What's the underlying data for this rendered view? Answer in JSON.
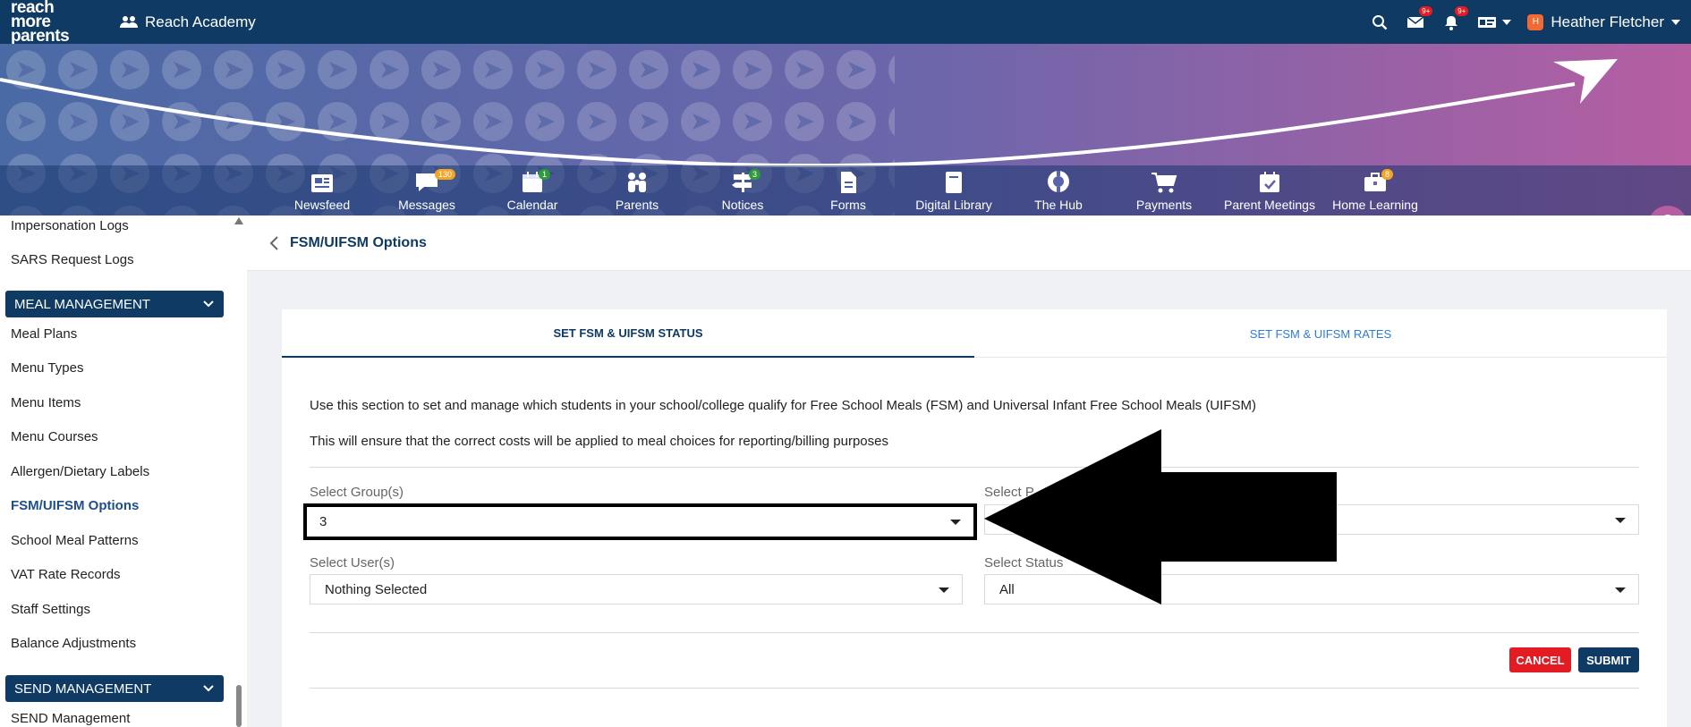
{
  "brand": {
    "line1": "reach more",
    "line2": "parents"
  },
  "school_name": "Reach Academy",
  "topbar": {
    "messages_badge": "9+",
    "notifications_badge": "9+",
    "user_initial": "H",
    "user_name": "Heather Fletcher"
  },
  "nav": [
    {
      "label": "Newsfeed",
      "icon": "newspaper-icon",
      "badge": ""
    },
    {
      "label": "Messages",
      "icon": "chat-icon",
      "badge": "130",
      "badge_color": "#f5a524"
    },
    {
      "label": "Calendar",
      "icon": "calendar-icon",
      "badge": "1",
      "badge_color": "#2e9b3a"
    },
    {
      "label": "Parents",
      "icon": "family-icon",
      "badge": ""
    },
    {
      "label": "Notices",
      "icon": "signpost-icon",
      "badge": "3",
      "badge_color": "#2e9b3a"
    },
    {
      "label": "Forms",
      "icon": "document-icon",
      "badge": ""
    },
    {
      "label": "Digital Library",
      "icon": "book-icon",
      "badge": ""
    },
    {
      "label": "The Hub",
      "icon": "lifebuoy-icon",
      "badge": ""
    },
    {
      "label": "Payments",
      "icon": "cart-icon",
      "badge": ""
    },
    {
      "label": "Parent Meetings",
      "icon": "calendar-check-icon",
      "badge": ""
    },
    {
      "label": "Home Learning",
      "icon": "briefcase-icon",
      "badge": "8",
      "badge_color": "#f5a524"
    }
  ],
  "sidebar": {
    "top_links": [
      "Impersonation Logs",
      "SARS Request Logs"
    ],
    "meal_section": "MEAL MANAGEMENT",
    "meal_links": [
      "Meal Plans",
      "Menu Types",
      "Menu Items",
      "Menu Courses",
      "Allergen/Dietary Labels",
      "FSM/UIFSM Options",
      "School Meal Patterns",
      "VAT Rate Records",
      "Staff Settings",
      "Balance Adjustments"
    ],
    "active_link": "FSM/UIFSM Options",
    "send_section": "SEND MANAGEMENT",
    "send_links": [
      "SEND Management"
    ]
  },
  "page_title": "FSM/UIFSM Options",
  "tabs": {
    "active": "SET FSM & UIFSM STATUS",
    "inactive": "SET FSM & UIFSM RATES"
  },
  "description": {
    "line1": "Use this section to set and manage which students in your school/college qualify for Free School Meals (FSM) and Universal Infant Free School Meals (UIFSM)",
    "line2": "This will ensure that the correct costs will be applied to meal choices for reporting/billing purposes"
  },
  "form": {
    "groups_label": "Select Group(s)",
    "groups_value": "3",
    "second_label": "Select P",
    "second_value": "",
    "users_label": "Select User(s)",
    "users_value": "Nothing Selected",
    "status_label": "Select Status",
    "status_value": "All"
  },
  "buttons": {
    "cancel": "CANCEL",
    "submit": "SUBMIT"
  },
  "colors": {
    "primary": "#0f3a63",
    "cancel": "#e31b23",
    "submit": "#0f3a63",
    "link": "#2f7bd6"
  }
}
